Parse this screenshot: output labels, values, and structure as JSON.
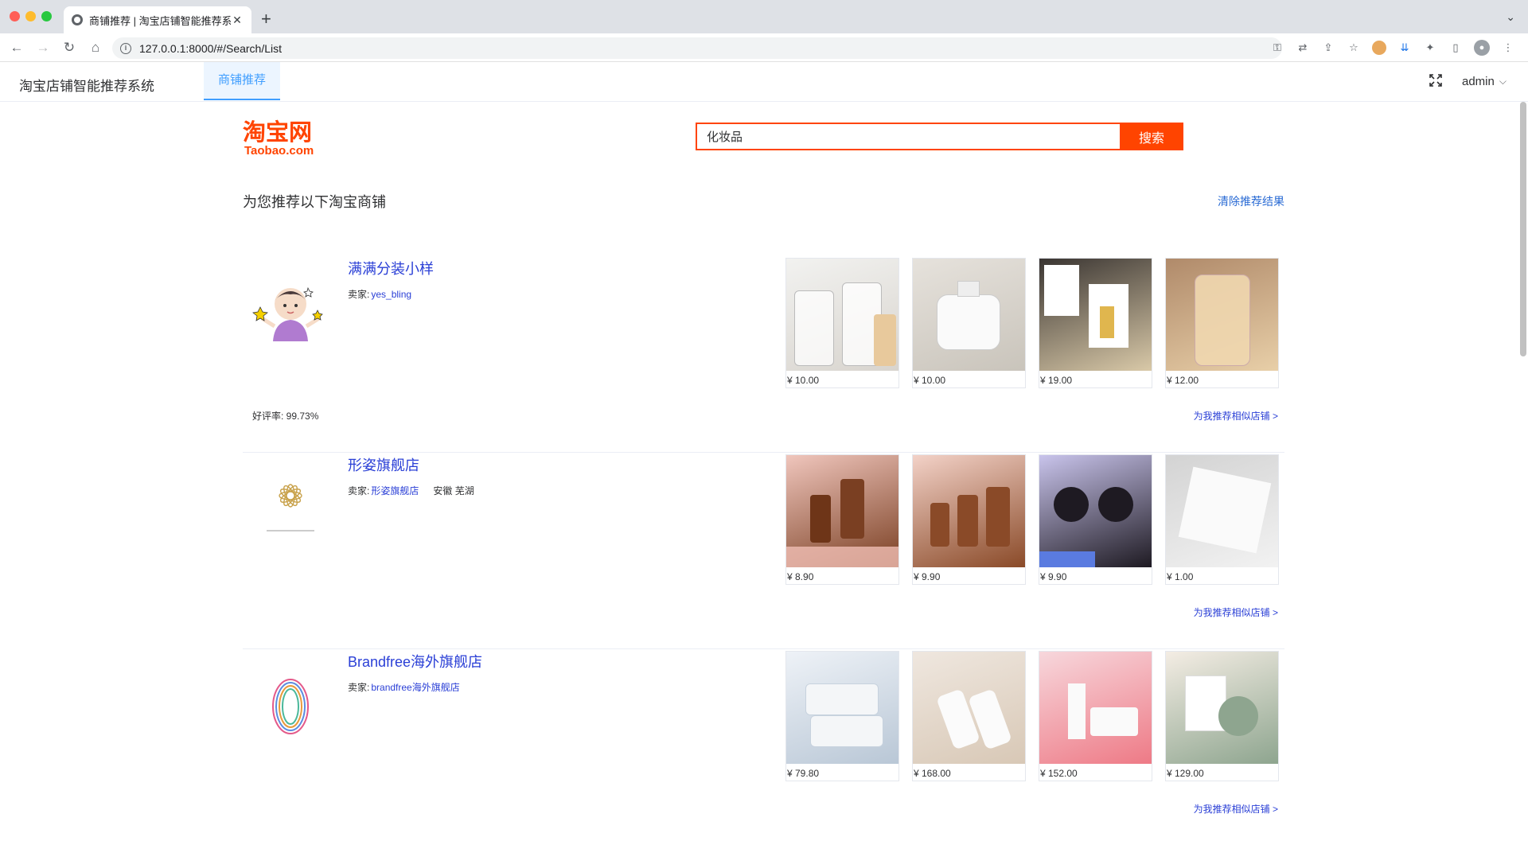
{
  "browser": {
    "tab_title": "商铺推荐 | 淘宝店铺智能推荐系统",
    "url": "127.0.0.1:8000/#/Search/List"
  },
  "app": {
    "title": "淘宝店铺智能推荐系统",
    "nav_tab": "商铺推荐",
    "user": "admin"
  },
  "search": {
    "logo_cn": "淘宝网",
    "logo_en": "Taobao.com",
    "query": "化妆品",
    "button_label": "搜索"
  },
  "results": {
    "title": "为您推荐以下淘宝商铺",
    "clear_label": "清除推荐结果",
    "similar_label": "为我推荐相似店铺 >",
    "seller_prefix": "卖家:",
    "shops": [
      {
        "name": "满满分装小样",
        "seller": "yes_bling",
        "location": "",
        "rating": "好评率: 99.73%",
        "products": [
          {
            "price": "¥ 10.00",
            "colors": [
              "#f2f2f0",
              "#d8d4ce"
            ]
          },
          {
            "price": "¥ 10.00",
            "colors": [
              "#e6e2dc",
              "#c9c4bb"
            ]
          },
          {
            "price": "¥ 19.00",
            "colors": [
              "#3a3532",
              "#d9c9a8"
            ]
          },
          {
            "price": "¥ 12.00",
            "colors": [
              "#b08a6a",
              "#e8cfa8"
            ]
          }
        ]
      },
      {
        "name": "形姿旗舰店",
        "seller": "形姿旗舰店",
        "location": "安徽 芜湖",
        "rating": "",
        "products": [
          {
            "price": "¥ 8.90",
            "colors": [
              "#f0c6bd",
              "#7a3f22"
            ]
          },
          {
            "price": "¥ 9.90",
            "colors": [
              "#f3d2c8",
              "#8a4a28"
            ]
          },
          {
            "price": "¥ 9.90",
            "colors": [
              "#c9c4ec",
              "#1e1a22"
            ]
          },
          {
            "price": "¥ 1.00",
            "colors": [
              "#d3d3d3",
              "#f2f2f2"
            ]
          }
        ]
      },
      {
        "name": "Brandfree海外旗舰店",
        "seller": "brandfree海外旗舰店",
        "location": "",
        "rating": "",
        "products": [
          {
            "price": "¥ 79.80",
            "colors": [
              "#eef2f7",
              "#b9c7d6"
            ]
          },
          {
            "price": "¥ 168.00",
            "colors": [
              "#efe7df",
              "#d8c8b6"
            ]
          },
          {
            "price": "¥ 152.00",
            "colors": [
              "#f7d7dc",
              "#ee7a86"
            ]
          },
          {
            "price": "¥ 129.00",
            "colors": [
              "#f4ede4",
              "#8ea58f"
            ]
          }
        ]
      }
    ]
  },
  "colors": {
    "accent": "#ff4400",
    "link": "#2a3fd6",
    "nav_active": "#409eff"
  }
}
